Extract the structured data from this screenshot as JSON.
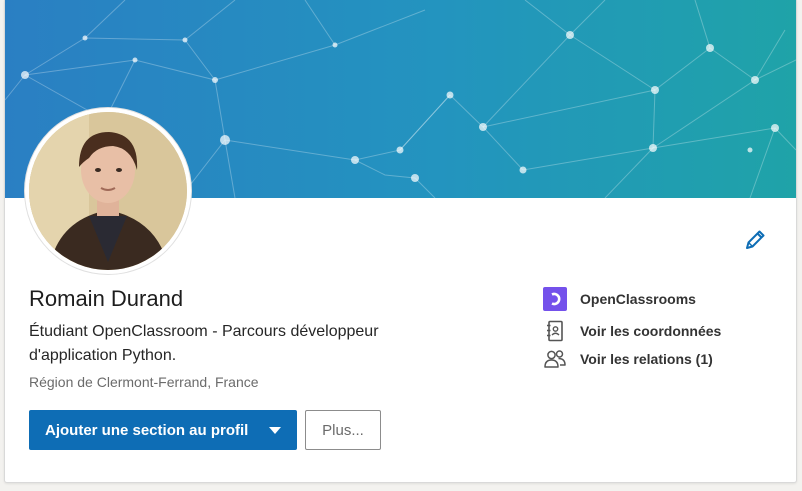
{
  "profile": {
    "name": "Romain Durand",
    "headline": "Étudiant OpenClassroom - Parcours développeur d'application Python.",
    "location": "Région de Clermont-Ferrand, France"
  },
  "actions": {
    "add_section_label": "Ajouter une section au profil",
    "more_label": "Plus..."
  },
  "sidebar_links": [
    {
      "label": "OpenClassrooms",
      "icon": "openclassrooms-logo-icon"
    },
    {
      "label": "Voir les coordonnées",
      "icon": "contact-card-icon"
    },
    {
      "label": "Voir les relations (1)",
      "icon": "people-icon"
    }
  ],
  "colors": {
    "primary_button": "#0e6db5",
    "banner_start": "#2a7fc3",
    "banner_end": "#1fa3a8",
    "openclassrooms_brand": "#7451eb",
    "edit_icon": "#0e6db5"
  }
}
